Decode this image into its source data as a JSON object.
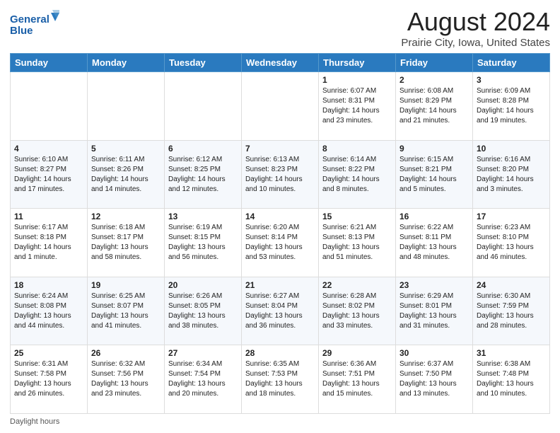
{
  "header": {
    "logo_line1": "General",
    "logo_line2": "Blue",
    "title": "August 2024",
    "subtitle": "Prairie City, Iowa, United States"
  },
  "weekdays": [
    "Sunday",
    "Monday",
    "Tuesday",
    "Wednesday",
    "Thursday",
    "Friday",
    "Saturday"
  ],
  "weeks": [
    [
      {
        "day": "",
        "info": ""
      },
      {
        "day": "",
        "info": ""
      },
      {
        "day": "",
        "info": ""
      },
      {
        "day": "",
        "info": ""
      },
      {
        "day": "1",
        "info": "Sunrise: 6:07 AM\nSunset: 8:31 PM\nDaylight: 14 hours and 23 minutes."
      },
      {
        "day": "2",
        "info": "Sunrise: 6:08 AM\nSunset: 8:29 PM\nDaylight: 14 hours and 21 minutes."
      },
      {
        "day": "3",
        "info": "Sunrise: 6:09 AM\nSunset: 8:28 PM\nDaylight: 14 hours and 19 minutes."
      }
    ],
    [
      {
        "day": "4",
        "info": "Sunrise: 6:10 AM\nSunset: 8:27 PM\nDaylight: 14 hours and 17 minutes."
      },
      {
        "day": "5",
        "info": "Sunrise: 6:11 AM\nSunset: 8:26 PM\nDaylight: 14 hours and 14 minutes."
      },
      {
        "day": "6",
        "info": "Sunrise: 6:12 AM\nSunset: 8:25 PM\nDaylight: 14 hours and 12 minutes."
      },
      {
        "day": "7",
        "info": "Sunrise: 6:13 AM\nSunset: 8:23 PM\nDaylight: 14 hours and 10 minutes."
      },
      {
        "day": "8",
        "info": "Sunrise: 6:14 AM\nSunset: 8:22 PM\nDaylight: 14 hours and 8 minutes."
      },
      {
        "day": "9",
        "info": "Sunrise: 6:15 AM\nSunset: 8:21 PM\nDaylight: 14 hours and 5 minutes."
      },
      {
        "day": "10",
        "info": "Sunrise: 6:16 AM\nSunset: 8:20 PM\nDaylight: 14 hours and 3 minutes."
      }
    ],
    [
      {
        "day": "11",
        "info": "Sunrise: 6:17 AM\nSunset: 8:18 PM\nDaylight: 14 hours and 1 minute."
      },
      {
        "day": "12",
        "info": "Sunrise: 6:18 AM\nSunset: 8:17 PM\nDaylight: 13 hours and 58 minutes."
      },
      {
        "day": "13",
        "info": "Sunrise: 6:19 AM\nSunset: 8:15 PM\nDaylight: 13 hours and 56 minutes."
      },
      {
        "day": "14",
        "info": "Sunrise: 6:20 AM\nSunset: 8:14 PM\nDaylight: 13 hours and 53 minutes."
      },
      {
        "day": "15",
        "info": "Sunrise: 6:21 AM\nSunset: 8:13 PM\nDaylight: 13 hours and 51 minutes."
      },
      {
        "day": "16",
        "info": "Sunrise: 6:22 AM\nSunset: 8:11 PM\nDaylight: 13 hours and 48 minutes."
      },
      {
        "day": "17",
        "info": "Sunrise: 6:23 AM\nSunset: 8:10 PM\nDaylight: 13 hours and 46 minutes."
      }
    ],
    [
      {
        "day": "18",
        "info": "Sunrise: 6:24 AM\nSunset: 8:08 PM\nDaylight: 13 hours and 44 minutes."
      },
      {
        "day": "19",
        "info": "Sunrise: 6:25 AM\nSunset: 8:07 PM\nDaylight: 13 hours and 41 minutes."
      },
      {
        "day": "20",
        "info": "Sunrise: 6:26 AM\nSunset: 8:05 PM\nDaylight: 13 hours and 38 minutes."
      },
      {
        "day": "21",
        "info": "Sunrise: 6:27 AM\nSunset: 8:04 PM\nDaylight: 13 hours and 36 minutes."
      },
      {
        "day": "22",
        "info": "Sunrise: 6:28 AM\nSunset: 8:02 PM\nDaylight: 13 hours and 33 minutes."
      },
      {
        "day": "23",
        "info": "Sunrise: 6:29 AM\nSunset: 8:01 PM\nDaylight: 13 hours and 31 minutes."
      },
      {
        "day": "24",
        "info": "Sunrise: 6:30 AM\nSunset: 7:59 PM\nDaylight: 13 hours and 28 minutes."
      }
    ],
    [
      {
        "day": "25",
        "info": "Sunrise: 6:31 AM\nSunset: 7:58 PM\nDaylight: 13 hours and 26 minutes."
      },
      {
        "day": "26",
        "info": "Sunrise: 6:32 AM\nSunset: 7:56 PM\nDaylight: 13 hours and 23 minutes."
      },
      {
        "day": "27",
        "info": "Sunrise: 6:34 AM\nSunset: 7:54 PM\nDaylight: 13 hours and 20 minutes."
      },
      {
        "day": "28",
        "info": "Sunrise: 6:35 AM\nSunset: 7:53 PM\nDaylight: 13 hours and 18 minutes."
      },
      {
        "day": "29",
        "info": "Sunrise: 6:36 AM\nSunset: 7:51 PM\nDaylight: 13 hours and 15 minutes."
      },
      {
        "day": "30",
        "info": "Sunrise: 6:37 AM\nSunset: 7:50 PM\nDaylight: 13 hours and 13 minutes."
      },
      {
        "day": "31",
        "info": "Sunrise: 6:38 AM\nSunset: 7:48 PM\nDaylight: 13 hours and 10 minutes."
      }
    ]
  ],
  "footer": {
    "label": "Daylight hours"
  }
}
